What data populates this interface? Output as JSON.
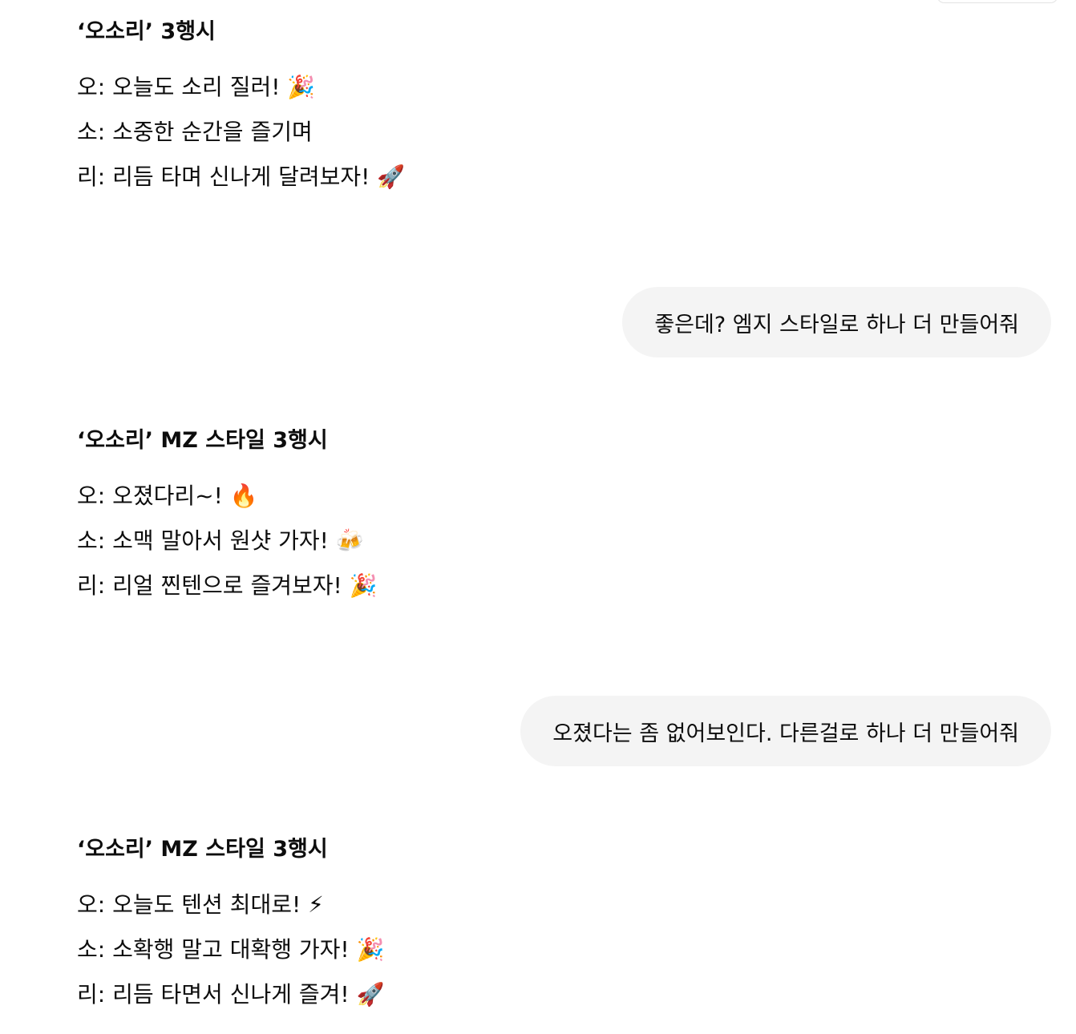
{
  "conversation": {
    "responses": [
      {
        "title": "‘오소리’ 3행시",
        "lines": [
          "오: 오늘도 소리 질러! 🎉",
          "소: 소중한 순간을 즐기며",
          "리: 리듬 타며 신나게 달려보자! 🚀"
        ]
      },
      {
        "title": "‘오소리’ MZ 스타일 3행시",
        "lines": [
          "오: 오졌다리~! 🔥",
          "소: 소맥 말아서 원샷 가자! 🍻",
          "리: 리얼 찐텐으로 즐겨보자! 🎉"
        ]
      },
      {
        "title": "‘오소리’ MZ 스타일 3행시",
        "lines": [
          "오: 오늘도 텐션 최대로! ⚡",
          "소: 소확행 말고 대확행 가자! 🎉",
          "리: 리듬 타면서 신나게 즐겨! 🚀"
        ]
      }
    ],
    "user_messages": [
      "좋은데? 엠지 스타일로 하나 더 만들어줘",
      "오졌다는 좀 없어보인다. 다른걸로 하나 더 만들어줘"
    ]
  },
  "colors": {
    "background": "#ffffff",
    "user_bubble": "#f4f4f4",
    "text": "#0d0d0d"
  }
}
